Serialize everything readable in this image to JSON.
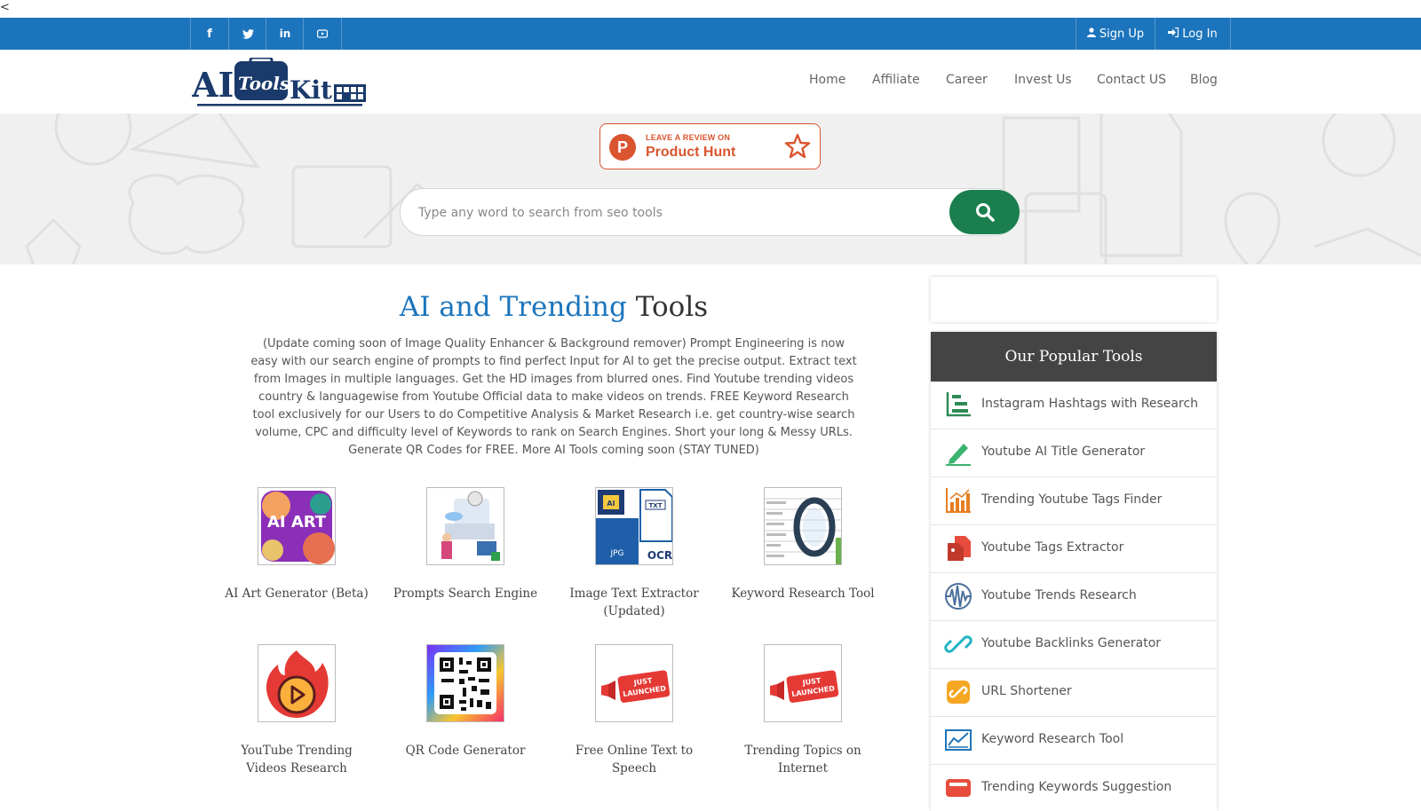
{
  "stray_char": "<",
  "topbar": {
    "social": [
      "facebook-icon",
      "twitter-icon",
      "linkedin-icon",
      "youtube-icon"
    ],
    "social_glyphs": [
      "f",
      "t",
      "in",
      "▶"
    ],
    "signup": "Sign Up",
    "login": "Log In",
    "bar_color": "#1c75bc"
  },
  "header": {
    "logo": {
      "t1": "AI",
      "t2": "Tools",
      "t3": "Kit.",
      "alt_name": "ai-tools-kit-logo"
    },
    "nav": [
      "Home",
      "Affiliate",
      "Career",
      "Invest Us",
      "Contact US",
      "Blog"
    ]
  },
  "hero": {
    "product_hunt": {
      "small": "LEAVE A REVIEW ON",
      "big": "Product Hunt",
      "letter": "P"
    },
    "search_placeholder": "Type any word to search from seo tools",
    "search_button_color": "#1a7f4d"
  },
  "main": {
    "title_part1": "AI and Trending",
    "title_part2": "Tools",
    "description": "(Update coming soon of Image Quality Enhancer & Background remover) Prompt Engineering is now easy with our search engine of prompts to find perfect Input for AI to get the precise output. Extract text from Images in multiple languages. Get the HD images from blurred ones. Find Youtube trending videos country & languagewise from Youtube Official data to make videos on trends. FREE Keyword Research tool exclusively for our Users to do Competitive Analysis & Market Research i.e. get country-wise search volume, CPC and difficulty level of Keywords to rank on Search Engines. Short your long & Messy URLs. Generate QR Codes for FREE. More AI Tools coming soon (STAY TUNED)",
    "tools": [
      {
        "label": "AI Art Generator (Beta)"
      },
      {
        "label": "Prompts Search Engine"
      },
      {
        "label": "Image Text Extractor (Updated)"
      },
      {
        "label": "Keyword Research Tool"
      },
      {
        "label": "YouTube Trending Videos Research"
      },
      {
        "label": "QR Code Generator"
      },
      {
        "label": "Free Online Text to Speech"
      },
      {
        "label": "Trending Topics on Internet"
      }
    ],
    "thumb_texts": {
      "ai_art": "AI ART",
      "ocr_ai": "AI",
      "ocr_txt": "TXT",
      "ocr_jpg": "JPG",
      "ocr": "OCR",
      "just_launched_1": "JUST",
      "just_launched_2": "LAUNCHED"
    }
  },
  "sidebar": {
    "heading": "Our Popular Tools",
    "items": [
      {
        "label": "Instagram Hashtags with Research",
        "icon": "chart-tree-icon"
      },
      {
        "label": "Youtube AI Title Generator",
        "icon": "pencil-icon"
      },
      {
        "label": "Trending Youtube Tags Finder",
        "icon": "bar-chart-icon"
      },
      {
        "label": "Youtube Tags Extractor",
        "icon": "file-tag-icon"
      },
      {
        "label": "Youtube Trends Research",
        "icon": "wave-icon"
      },
      {
        "label": "Youtube Backlinks Generator",
        "icon": "link-icon"
      },
      {
        "label": "URL Shortener",
        "icon": "url-link-icon"
      },
      {
        "label": "Keyword Research Tool",
        "icon": "analytics-icon"
      },
      {
        "label": "Trending Keywords Suggestion",
        "icon": "seo-icon"
      }
    ]
  }
}
